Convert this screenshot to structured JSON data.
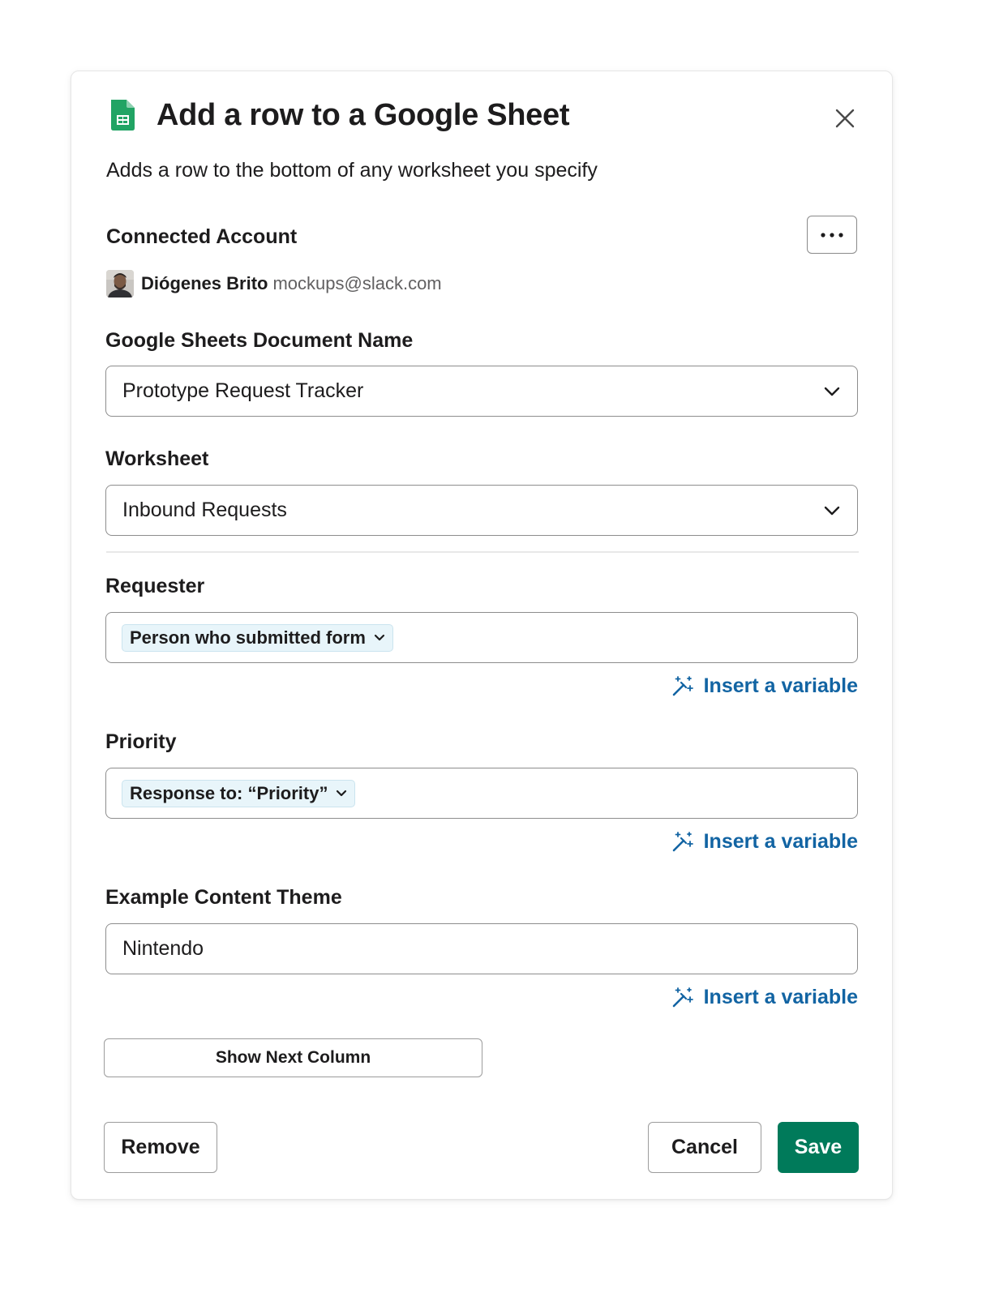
{
  "modal": {
    "title": "Add a row to a Google Sheet",
    "subtitle": "Adds a row to the bottom of any worksheet you specify",
    "icons": {
      "app": "google-sheets-icon",
      "close": "close-icon",
      "more": "more-horizontal-icon"
    }
  },
  "account": {
    "label": "Connected Account",
    "name": "Diógenes Brito",
    "email": "mockups@slack.com"
  },
  "document": {
    "label": "Google Sheets Document Name",
    "value": "Prototype Request Tracker"
  },
  "worksheet": {
    "label": "Worksheet",
    "value": "Inbound Requests"
  },
  "requester": {
    "label": "Requester",
    "token": "Person who submitted form",
    "insert_label": "Insert a variable"
  },
  "priority": {
    "label": "Priority",
    "token": "Response to: “Priority”",
    "insert_label": "Insert a variable"
  },
  "theme": {
    "label": "Example Content Theme",
    "value": "Nintendo",
    "insert_label": "Insert a variable"
  },
  "actions": {
    "show_next": "Show Next Column",
    "remove": "Remove",
    "cancel": "Cancel",
    "save": "Save"
  },
  "colors": {
    "save_bg": "#007a5a",
    "link": "#1264a3",
    "sheets_green": "#0f9d58",
    "token_bg": "#e8f5fa"
  }
}
